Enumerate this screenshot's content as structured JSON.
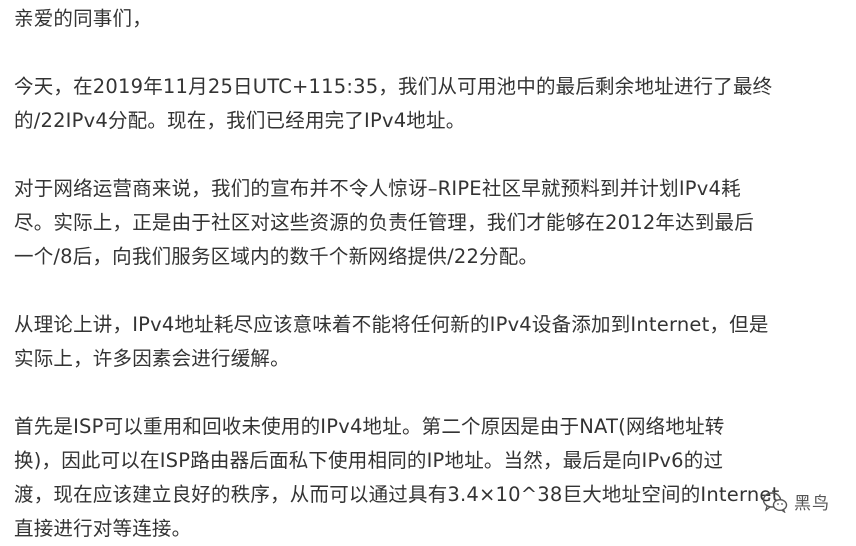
{
  "article": {
    "greeting": "亲爱的同事们，",
    "p1": [
      "今天，在2019年11月25日UTC+115:35，我们从可用池中的最后剩余地址进行了最终",
      "的/22IPv4分配。现在，我们已经用完了IPv4地址。"
    ],
    "p2": [
      "对于网络运营商来说，我们的宣布并不令人惊讶–RIPE社区早就预料到并计划IPv4耗",
      "尽。实际上，正是由于社区对这些资源的负责任管理，我们才能够在2012年达到最后",
      "一个/8后，向我们服务区域内的数千个新网络提供/22分配。"
    ],
    "p3": [
      "从理论上讲，IPv4地址耗尽应该意味着不能将任何新的IPv4设备添加到Internet，但是",
      "实际上，许多因素会进行缓解。"
    ],
    "p4": [
      "首先是ISP可以重用和回收未使用的IPv4地址。第二个原因是由于NAT(网络地址转",
      "换)，因此可以在ISP路由器后面私下使用相同的IP地址。当然，最后是向IPv6的过",
      "渡，现在应该建立良好的秩序，从而可以通过具有3.4×10^38巨大地址空间的Internet",
      "直接进行对等连接。"
    ]
  },
  "watermark": {
    "icon": "wechat-icon",
    "text": "黑鸟"
  },
  "colors": {
    "text": "#333333",
    "background": "#ffffff",
    "watermark": "#555555"
  }
}
